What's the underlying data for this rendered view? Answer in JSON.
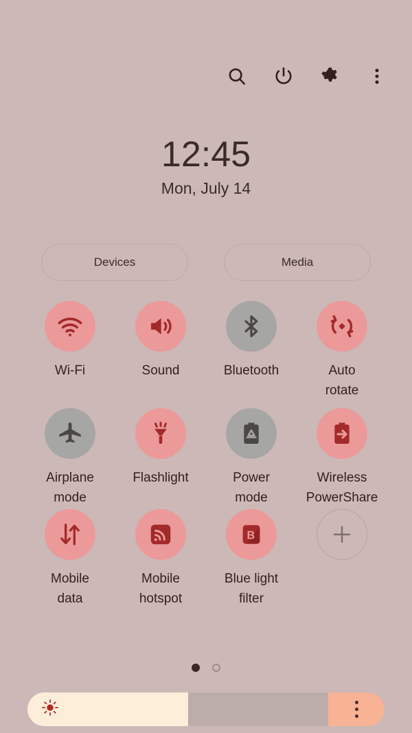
{
  "statusbar": {
    "icons": [
      {
        "name": "search-icon",
        "label": "Search"
      },
      {
        "name": "power-icon",
        "label": "Power off"
      },
      {
        "name": "gear-icon",
        "label": "Settings"
      },
      {
        "name": "overflow-menu-icon",
        "label": "More options"
      }
    ]
  },
  "clock": {
    "time": "12:45",
    "date": "Mon, July 14"
  },
  "chips": {
    "devices_label": "Devices",
    "media_label": "Media"
  },
  "tiles": [
    {
      "id": "wifi",
      "label": "Wi-Fi",
      "icon": "wifi-icon",
      "state": "on"
    },
    {
      "id": "sound",
      "label": "Sound",
      "icon": "sound-icon",
      "state": "on"
    },
    {
      "id": "bluetooth",
      "label": "Bluetooth",
      "icon": "bluetooth-icon",
      "state": "off"
    },
    {
      "id": "auto-rotate",
      "label": "Auto\nrotate",
      "icon": "auto-rotate-icon",
      "state": "on"
    },
    {
      "id": "airplane-mode",
      "label": "Airplane\nmode",
      "icon": "airplane-icon",
      "state": "off"
    },
    {
      "id": "flashlight",
      "label": "Flashlight",
      "icon": "flashlight-icon",
      "state": "on"
    },
    {
      "id": "power-mode",
      "label": "Power\nmode",
      "icon": "battery-recycle-icon",
      "state": "off"
    },
    {
      "id": "wireless-powershare",
      "label": "Wireless\nPowerShare",
      "icon": "battery-share-icon",
      "state": "on"
    },
    {
      "id": "mobile-data",
      "label": "Mobile\ndata",
      "icon": "mobile-data-icon",
      "state": "on"
    },
    {
      "id": "mobile-hotspot",
      "label": "Mobile\nhotspot",
      "icon": "hotspot-icon",
      "state": "on"
    },
    {
      "id": "blue-light-filter",
      "label": "Blue light\nfilter",
      "icon": "blue-light-filter-icon",
      "state": "on"
    },
    {
      "id": "add-tile",
      "label": "",
      "icon": "plus-icon",
      "state": "add"
    }
  ],
  "pager": {
    "pages": 2,
    "current": 1
  },
  "brightness": {
    "icon": "brightness-sun-icon",
    "value_percent": 45,
    "menu_icon": "overflow-menu-icon"
  },
  "colors": {
    "background": "#ccb8b7",
    "tile_on": "#eb9999",
    "tile_on_icon": "#a32a2a",
    "tile_off": "#a6a6a4",
    "tile_off_icon": "#4a4745",
    "text": "#33201e",
    "slider_fill": "#fdeeda",
    "slider_track": "#bcacaa",
    "slider_end": "#f8b294"
  }
}
